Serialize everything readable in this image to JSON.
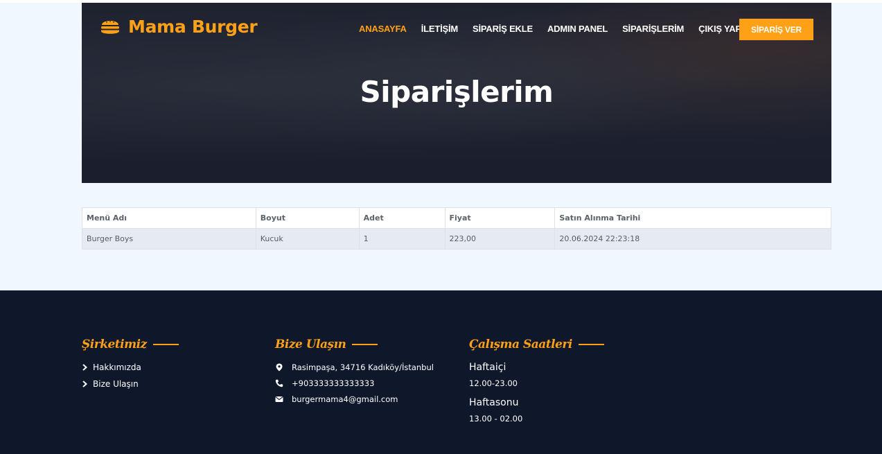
{
  "brand": {
    "name": "Mama Burger",
    "icon": "hamburger-icon",
    "accent": "#fea116"
  },
  "nav": {
    "items": [
      {
        "label": "ANASAYFA",
        "active": true
      },
      {
        "label": "İLETİŞİM"
      },
      {
        "label": "SİPARİŞ EKLE"
      },
      {
        "label": "ADMIN PANEL"
      },
      {
        "label": "SİPARİŞLERİM"
      },
      {
        "label": "ÇIKIŞ YAP"
      }
    ],
    "cta_label": "SİPARİŞ VER"
  },
  "hero": {
    "title": "Siparişlerim"
  },
  "orders": {
    "headers": [
      "Menü Adı",
      "Boyut",
      "Adet",
      "Fiyat",
      "Satın Alınma Tarihi"
    ],
    "rows": [
      [
        "Burger Boys",
        "Kucuk",
        "1",
        "223,00",
        "20.06.2024 22:23:18"
      ]
    ]
  },
  "footer": {
    "company": {
      "heading": "Şirketimiz",
      "links": [
        "Hakkımızda",
        "Bize Ulaşın"
      ]
    },
    "contact": {
      "heading": "Bize Ulaşın",
      "address": "Rasimpaşa, 34716 Kadıköy/İstanbul",
      "phone": "+903333333333333",
      "email": "burgermama4@gmail.com"
    },
    "hours": {
      "heading": "Çalışma Saatleri",
      "weekday_label": "Haftaiçi",
      "weekday_hours": "12.00-23.00",
      "weekend_label": "Haftasonu",
      "weekend_hours": "13.00 - 02.00"
    }
  }
}
